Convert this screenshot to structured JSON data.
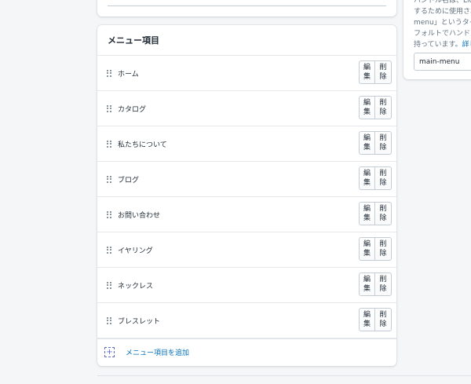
{
  "side_panel": {
    "text_line1": "ハンドル名は、Liqu",
    "text_line2": "するために使用され",
    "text_line3": "menu」というタイ",
    "text_line4": "フォルトでハンドル",
    "text_line5_prefix": "持っています。",
    "text_line5_link": "詳し",
    "handle_value": "main-menu"
  },
  "menu": {
    "title": "メニュー項目",
    "edit_label": "編集",
    "delete_label": "削除",
    "items": [
      {
        "label": "ホーム"
      },
      {
        "label": "カタログ"
      },
      {
        "label": "私たちについて"
      },
      {
        "label": "ブログ"
      },
      {
        "label": "お問い合わせ"
      },
      {
        "label": "イヤリング"
      },
      {
        "label": "ネックレス"
      },
      {
        "label": "ブレスレット"
      }
    ],
    "add_label": "メニュー項目を追加"
  },
  "colors": {
    "link": "#006fbb",
    "accent": "#5c6ac4",
    "background": "#f4f6f8"
  },
  "icons": {
    "drag": "drag-handle-icon",
    "add": "add-item-icon"
  }
}
